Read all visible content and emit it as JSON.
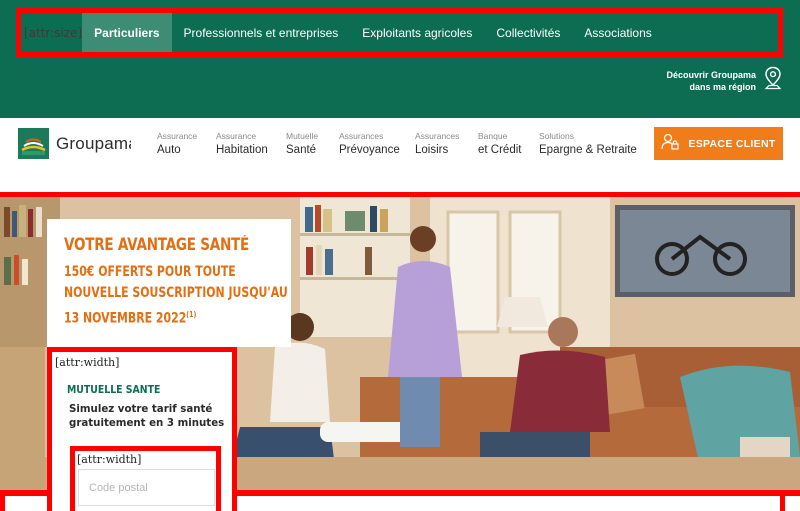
{
  "segment_nav": {
    "attr_tag": "[attr:size]",
    "items": [
      {
        "label": "Particuliers",
        "active": true
      },
      {
        "label": "Professionnels et entreprises",
        "active": false
      },
      {
        "label": "Exploitants agricoles",
        "active": false
      },
      {
        "label": "Collectivités",
        "active": false
      },
      {
        "label": "Associations",
        "active": false
      }
    ]
  },
  "discover": {
    "line1": "Découvrir Groupama",
    "line2": "dans ma région",
    "icon": "map-pin-icon"
  },
  "header": {
    "logo_text": "Groupama",
    "menu": [
      {
        "small": "Assurance",
        "big": "Auto"
      },
      {
        "small": "Assurance",
        "big": "Habitation"
      },
      {
        "small": "Mutuelle",
        "big": "Santé"
      },
      {
        "small": "Assurances",
        "big": "Prévoyance"
      },
      {
        "small": "Assurances",
        "big": "Loisirs"
      },
      {
        "small": "Banque",
        "big": "et Crédit"
      },
      {
        "small": "Solutions",
        "big": "Epargne & Retraite"
      }
    ],
    "espace_client": "ESPACE CLIENT"
  },
  "promo": {
    "title": "VOTRE AVANTAGE SANTÉ",
    "line1": "150€ OFFERTS POUR TOUTE",
    "line2": "NOUVELLE SOUSCRIPTION JUSQU'AU",
    "line3": "13 NOVEMBRE 2022",
    "footnote": "(1)"
  },
  "simulator": {
    "attr_tag": "[attr:width]",
    "kicker": "MUTUELLE SANTE",
    "text_line1": "Simulez votre tarif santé",
    "text_line2": "gratuitement en 3 minutes",
    "input_attr_tag": "[attr:width]",
    "postal_placeholder": "Code postal"
  },
  "colors": {
    "brand_green": "#0d6d52",
    "accent_orange": "#f07c1a",
    "annotation_red": "#ff0000"
  }
}
